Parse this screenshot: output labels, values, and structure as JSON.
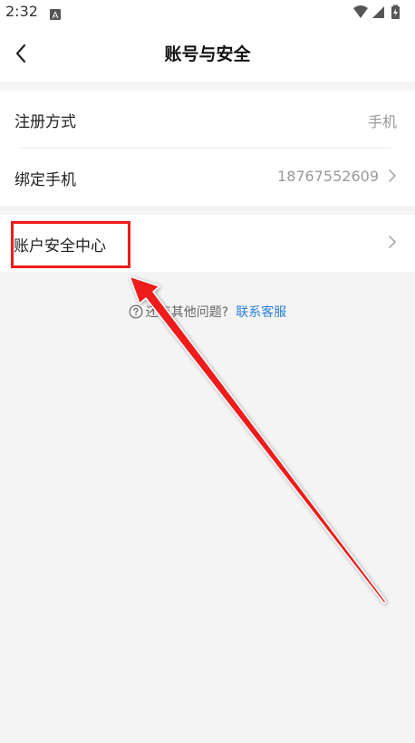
{
  "status_bar": {
    "time": "2:32"
  },
  "nav": {
    "title": "账号与安全"
  },
  "rows": [
    {
      "label": "注册方式",
      "value": "手机"
    },
    {
      "label": "绑定手机",
      "value": "18767552609"
    },
    {
      "label": "账户安全中心",
      "value": ""
    }
  ],
  "help": {
    "text": "还有其他问题?",
    "link": "联系客服"
  },
  "colors": {
    "highlight": "#ee1c1c",
    "link": "#2b7fd9",
    "background": "#f4f4f4"
  }
}
